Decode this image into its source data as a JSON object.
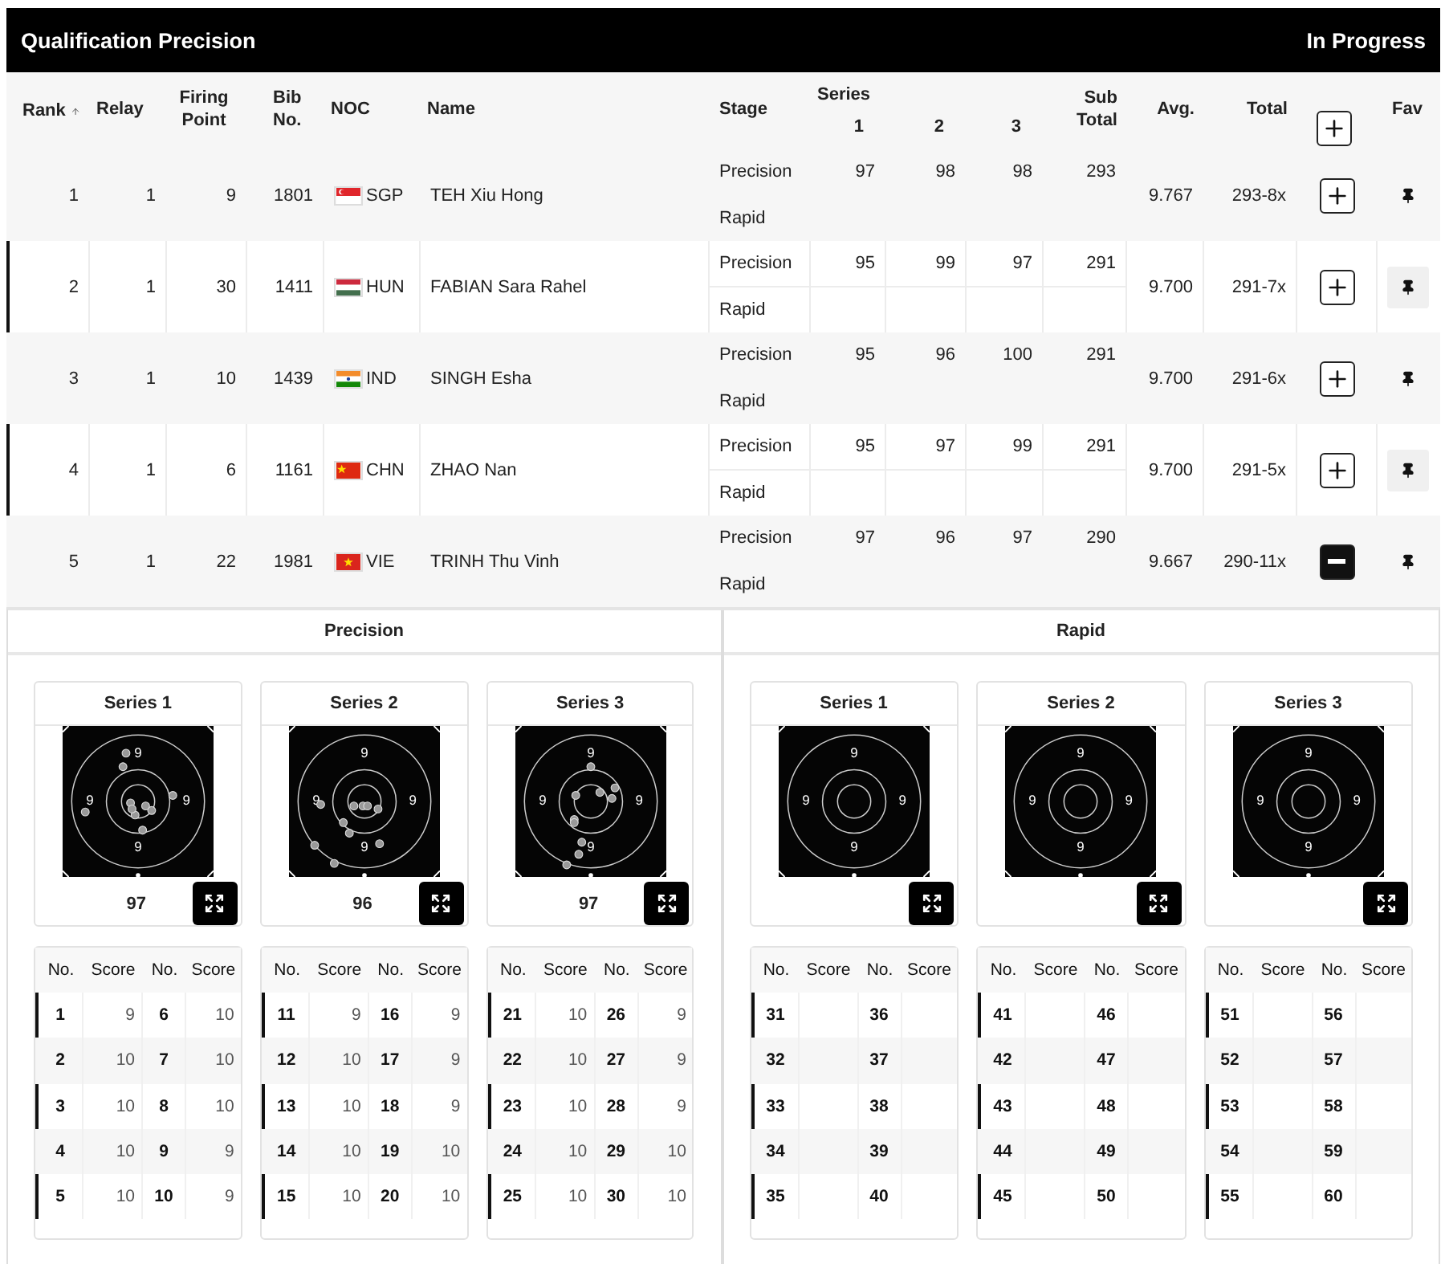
{
  "title_bar": {
    "title": "Qualification Precision",
    "status": "In Progress"
  },
  "table": {
    "columns": {
      "rank": "Rank",
      "relay": "Relay",
      "firing_point": "Firing Point",
      "bib": "Bib No.",
      "noc": "NOC",
      "name": "Name",
      "stage": "Stage",
      "series": "Series",
      "series_numbers": [
        "1",
        "2",
        "3"
      ],
      "sub_total": "Sub Total",
      "avg": "Avg.",
      "total": "Total",
      "fav": "Fav"
    },
    "rows": [
      {
        "rank": "1",
        "relay": "1",
        "firing_point": "9",
        "bib": "1801",
        "flag": {
          "kind": "singapore"
        },
        "noc": "SGP",
        "name": "TEH Xiu Hong",
        "stages": [
          {
            "stage": "Precision",
            "series": [
              "97",
              "98",
              "98"
            ],
            "sub_total": "293"
          },
          {
            "stage": "Rapid"
          }
        ],
        "avg": "9.767",
        "total": "293-8x",
        "expanded": false
      },
      {
        "rank": "2",
        "relay": "1",
        "firing_point": "30",
        "bib": "1411",
        "flag": {
          "kind": "hungary"
        },
        "noc": "HUN",
        "name": "FABIAN Sara Rahel",
        "stages": [
          {
            "stage": "Precision",
            "series": [
              "95",
              "99",
              "97"
            ],
            "sub_total": "291"
          },
          {
            "stage": "Rapid"
          }
        ],
        "avg": "9.700",
        "total": "291-7x",
        "expanded": false
      },
      {
        "rank": "3",
        "relay": "1",
        "firing_point": "10",
        "bib": "1439",
        "flag": {
          "kind": "india"
        },
        "noc": "IND",
        "name": "SINGH Esha",
        "stages": [
          {
            "stage": "Precision",
            "series": [
              "95",
              "96",
              "100"
            ],
            "sub_total": "291"
          },
          {
            "stage": "Rapid"
          }
        ],
        "avg": "9.700",
        "total": "291-6x",
        "expanded": false
      },
      {
        "rank": "4",
        "relay": "1",
        "firing_point": "6",
        "bib": "1161",
        "flag": {
          "kind": "china"
        },
        "noc": "CHN",
        "name": "ZHAO Nan",
        "stages": [
          {
            "stage": "Precision",
            "series": [
              "95",
              "97",
              "99"
            ],
            "sub_total": "291"
          },
          {
            "stage": "Rapid"
          }
        ],
        "avg": "9.700",
        "total": "291-5x",
        "expanded": false
      },
      {
        "rank": "5",
        "relay": "1",
        "firing_point": "22",
        "bib": "1981",
        "flag": {
          "kind": "vietnam"
        },
        "noc": "VIE",
        "name": "TRINH Thu Vinh",
        "stages": [
          {
            "stage": "Precision",
            "series": [
              "97",
              "96",
              "97"
            ],
            "sub_total": "290"
          },
          {
            "stage": "Rapid"
          }
        ],
        "avg": "9.667",
        "total": "290-11x",
        "expanded": true
      }
    ]
  },
  "detail": {
    "stages": [
      {
        "title": "Precision",
        "series": [
          {
            "title": "Series 1",
            "ring_labels": [
              "9",
              "9",
              "9",
              "9"
            ],
            "has_shots": true,
            "headers": [
              "No.",
              "Score",
              "No.",
              "Score"
            ],
            "score": "97",
            "shots": [
              {
                "no": "1",
                "score": "9"
              },
              {
                "no": "2",
                "score": "10"
              },
              {
                "no": "3",
                "score": "10"
              },
              {
                "no": "4",
                "score": "10"
              },
              {
                "no": "5",
                "score": "10"
              },
              {
                "no": "6",
                "score": "10"
              },
              {
                "no": "7",
                "score": "10"
              },
              {
                "no": "8",
                "score": "10"
              },
              {
                "no": "9",
                "score": "9"
              },
              {
                "no": "10",
                "score": "9"
              }
            ]
          },
          {
            "title": "Series 2",
            "ring_labels": [
              "9",
              "9",
              "9",
              "9"
            ],
            "has_shots": true,
            "headers": [
              "No.",
              "Score",
              "No.",
              "Score"
            ],
            "score": "96",
            "shots": [
              {
                "no": "11",
                "score": "9"
              },
              {
                "no": "12",
                "score": "10"
              },
              {
                "no": "13",
                "score": "10"
              },
              {
                "no": "14",
                "score": "10"
              },
              {
                "no": "15",
                "score": "10"
              },
              {
                "no": "16",
                "score": "9"
              },
              {
                "no": "17",
                "score": "9"
              },
              {
                "no": "18",
                "score": "9"
              },
              {
                "no": "19",
                "score": "10"
              },
              {
                "no": "20",
                "score": "10"
              }
            ]
          },
          {
            "title": "Series 3",
            "ring_labels": [
              "9",
              "9",
              "9",
              "9"
            ],
            "has_shots": true,
            "headers": [
              "No.",
              "Score",
              "No.",
              "Score"
            ],
            "score": "97",
            "shots": [
              {
                "no": "21",
                "score": "10"
              },
              {
                "no": "22",
                "score": "10"
              },
              {
                "no": "23",
                "score": "10"
              },
              {
                "no": "24",
                "score": "10"
              },
              {
                "no": "25",
                "score": "10"
              },
              {
                "no": "26",
                "score": "9"
              },
              {
                "no": "27",
                "score": "9"
              },
              {
                "no": "28",
                "score": "9"
              },
              {
                "no": "29",
                "score": "10"
              },
              {
                "no": "30",
                "score": "10"
              }
            ]
          }
        ]
      },
      {
        "title": "Rapid",
        "series": [
          {
            "title": "Series 1",
            "ring_labels": [
              "9",
              "9",
              "9",
              "9"
            ],
            "has_shots": false,
            "headers": [
              "No.",
              "Score",
              "No.",
              "Score"
            ],
            "shots": [
              {
                "no": "31"
              },
              {
                "no": "32"
              },
              {
                "no": "33"
              },
              {
                "no": "34"
              },
              {
                "no": "35"
              },
              {
                "no": "36"
              },
              {
                "no": "37"
              },
              {
                "no": "38"
              },
              {
                "no": "39"
              },
              {
                "no": "40"
              }
            ]
          },
          {
            "title": "Series 2",
            "ring_labels": [
              "9",
              "9",
              "9",
              "9"
            ],
            "has_shots": false,
            "headers": [
              "No.",
              "Score",
              "No.",
              "Score"
            ],
            "shots": [
              {
                "no": "41"
              },
              {
                "no": "42"
              },
              {
                "no": "43"
              },
              {
                "no": "44"
              },
              {
                "no": "45"
              },
              {
                "no": "46"
              },
              {
                "no": "47"
              },
              {
                "no": "48"
              },
              {
                "no": "49"
              },
              {
                "no": "50"
              }
            ]
          },
          {
            "title": "Series 3",
            "ring_labels": [
              "9",
              "9",
              "9",
              "9"
            ],
            "has_shots": false,
            "headers": [
              "No.",
              "Score",
              "No.",
              "Score"
            ],
            "shots": [
              {
                "no": "51"
              },
              {
                "no": "52"
              },
              {
                "no": "53"
              },
              {
                "no": "54"
              },
              {
                "no": "55"
              },
              {
                "no": "56"
              },
              {
                "no": "57"
              },
              {
                "no": "58"
              },
              {
                "no": "59"
              },
              {
                "no": "60"
              }
            ]
          }
        ]
      }
    ]
  }
}
